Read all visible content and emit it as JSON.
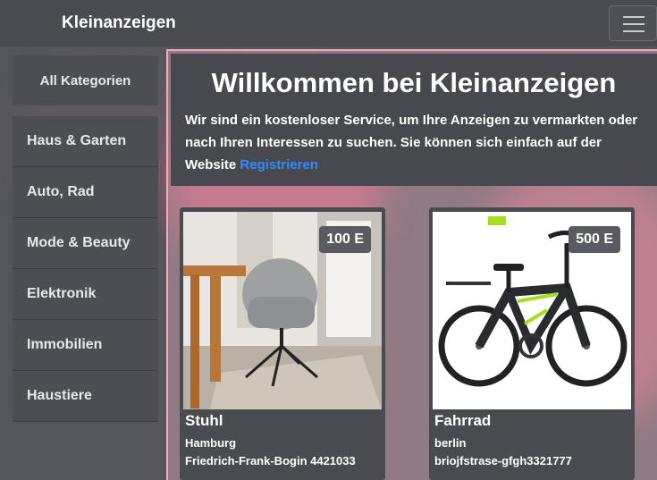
{
  "navbar": {
    "brand": "Kleinanzeigen",
    "menu_icon": "hamburger-menu-icon"
  },
  "sidebar": {
    "header": "All Kategorien",
    "items": [
      {
        "label": "Haus & Garten"
      },
      {
        "label": "Auto, Rad"
      },
      {
        "label": "Mode & Beauty"
      },
      {
        "label": "Elektronik"
      },
      {
        "label": "Immobilien"
      },
      {
        "label": "Haustiere"
      }
    ]
  },
  "hero": {
    "title": "Willkommen bei Kleinanzeigen",
    "text": "Wir sind ein kostenloser Service, um Ihre Anzeigen zu vermarkten oder nach Ihren Interessen zu suchen. Sie können sich einfach auf der Website",
    "link": "Registrieren"
  },
  "listings": [
    {
      "title": "Stuhl",
      "price": "100 E",
      "city": "Hamburg",
      "address": "Friedrich-Frank-Bogin 4421033",
      "image_icon": "chair-image"
    },
    {
      "title": "Fahrrad",
      "price": "500 E",
      "city": "berlin",
      "address": "briojfstrase-gfgh3321777",
      "image_icon": "bicycle-image"
    }
  ],
  "colors": {
    "navbar": "#4a4b51",
    "accent_link": "#2e8bff",
    "frame_border": "#f2a9b9"
  }
}
